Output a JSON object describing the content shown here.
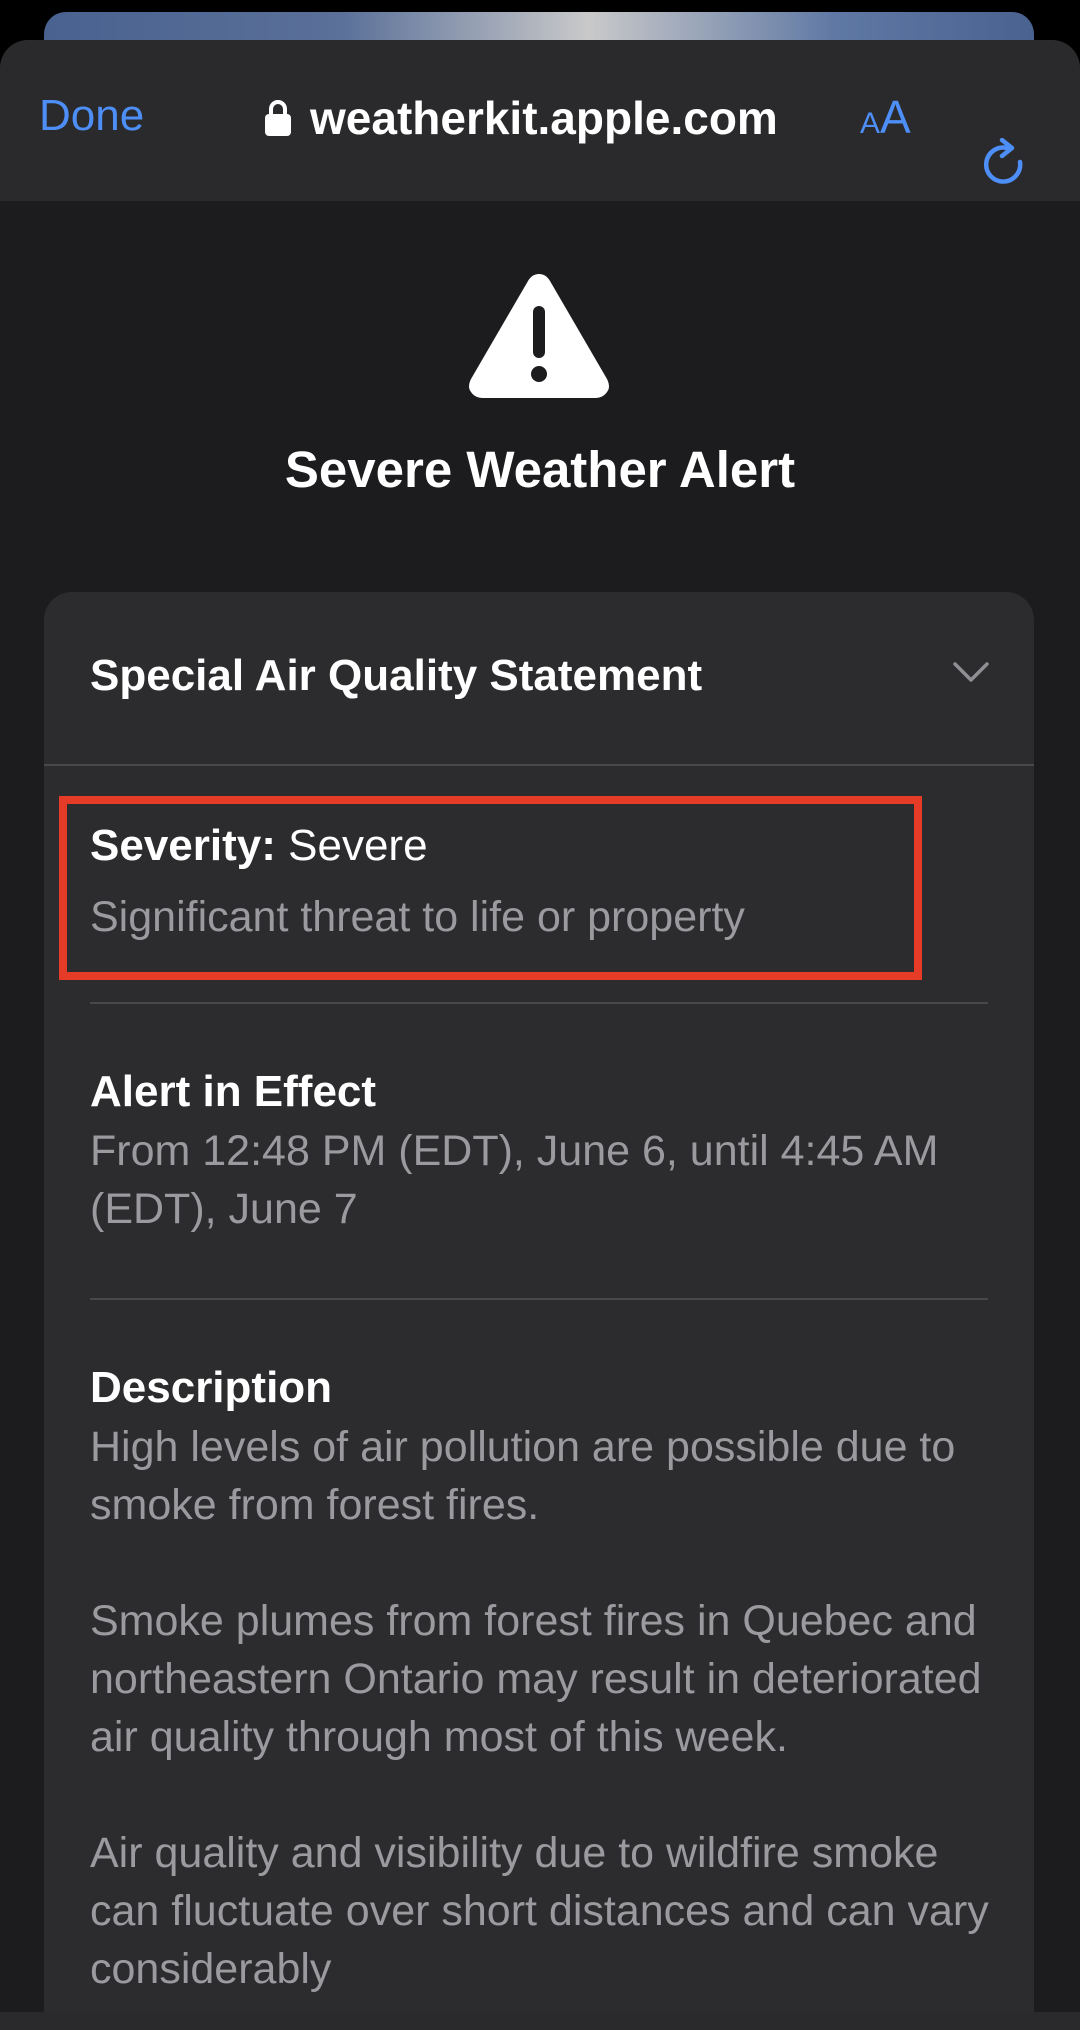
{
  "browser": {
    "done_label": "Done",
    "url": "weatherkit.apple.com",
    "text_size_small": "A",
    "text_size_large": "A",
    "accent_color": "#4d8ef7"
  },
  "alert": {
    "title": "Severe Weather Alert",
    "icon": "warning-triangle-icon"
  },
  "card": {
    "header": "Special Air Quality Statement",
    "severity": {
      "label": "Severity:",
      "value": "Severe",
      "description": "Significant threat to life or property",
      "highlight_color": "#e63b26"
    },
    "effect": {
      "title": "Alert in Effect",
      "text": "From 12:48 PM (EDT), June 6, until 4:45 AM (EDT), June 7"
    },
    "description": {
      "title": "Description",
      "paragraphs": [
        "High levels of air pollution are possible due to smoke from forest fires.",
        "Smoke plumes from forest fires in Quebec and northeastern Ontario may result in deteriorated air quality through most of this week.",
        "Air quality and visibility due to wildfire smoke can fluctuate over short distances and can vary considerably"
      ]
    }
  }
}
